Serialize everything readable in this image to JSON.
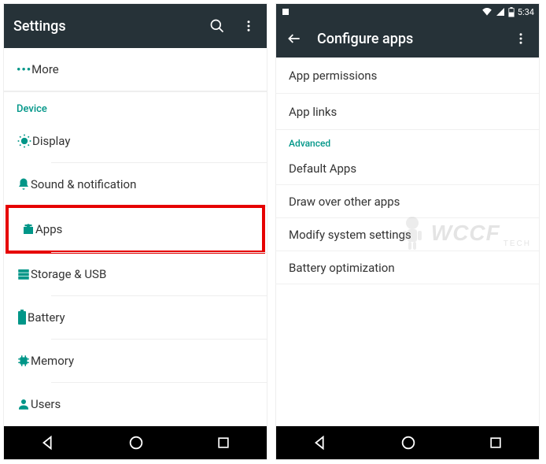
{
  "left": {
    "appbar_title": "Settings",
    "items_top": [
      {
        "label": "More"
      }
    ],
    "section_device": "Device",
    "items": [
      {
        "label": "Display"
      },
      {
        "label": "Sound & notification"
      },
      {
        "label": "Apps",
        "highlighted": true
      },
      {
        "label": "Storage & USB"
      },
      {
        "label": "Battery"
      },
      {
        "label": "Memory"
      },
      {
        "label": "Users"
      }
    ]
  },
  "right": {
    "status_time": "5:34",
    "appbar_title": "Configure apps",
    "items": [
      {
        "label": "App permissions"
      },
      {
        "label": "App links"
      }
    ],
    "section_advanced": "Advanced",
    "items_advanced": [
      {
        "label": "Default Apps"
      },
      {
        "label": "Draw over other apps"
      },
      {
        "label": "Modify system settings"
      },
      {
        "label": "Battery optimization"
      }
    ]
  },
  "watermark": {
    "main": "WCCF",
    "sub": "TECH"
  }
}
